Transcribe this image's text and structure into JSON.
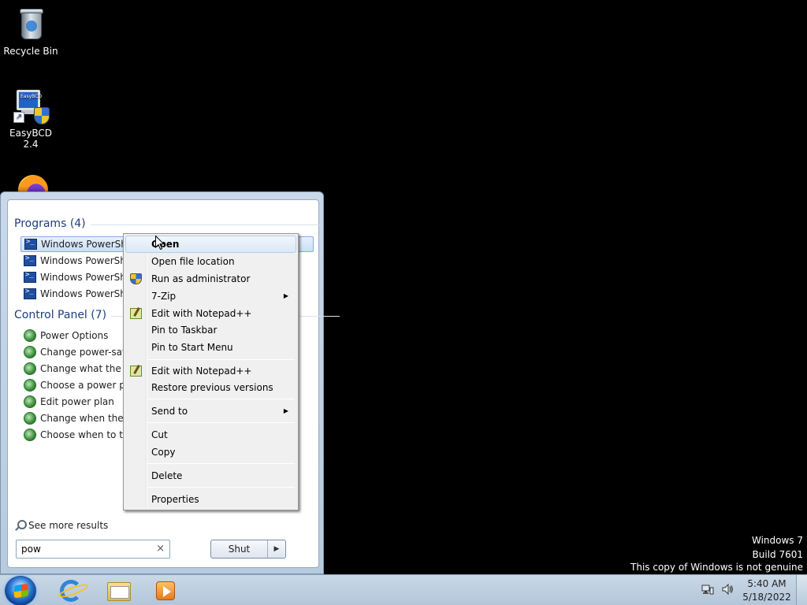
{
  "desktop": {
    "icons": [
      {
        "label": "Recycle Bin",
        "icon": "recycle-bin-icon"
      },
      {
        "label": "EasyBCD 2.4",
        "icon": "easybcd-icon"
      },
      {
        "label": "",
        "icon": "firefox-icon"
      }
    ],
    "easybcd_screen_text": "EasyBCD"
  },
  "start_menu": {
    "programs_header": "Programs (4)",
    "programs": [
      {
        "label": "Windows PowerShell",
        "selected": true
      },
      {
        "label": "Windows PowerShell"
      },
      {
        "label": "Windows PowerShell"
      },
      {
        "label": "Windows PowerShell"
      }
    ],
    "control_panel_header": "Control Panel (7)",
    "control_panel_items": [
      {
        "label": "Power Options"
      },
      {
        "label": "Change power-saving settings"
      },
      {
        "label": "Change what the power buttons do"
      },
      {
        "label": "Choose a power plan"
      },
      {
        "label": "Edit power plan"
      },
      {
        "label": "Change when the computer sleeps"
      },
      {
        "label": "Choose when to turn off display"
      }
    ],
    "see_more": "See more results",
    "search": {
      "value": "pow",
      "clear_icon": "×"
    },
    "shutdown_label": "Shut down",
    "shutdown_arrow": "▶"
  },
  "context_menu": {
    "items": [
      {
        "label": "Open",
        "bold": true,
        "hover": true
      },
      {
        "label": "Open file location"
      },
      {
        "label": "Run as administrator",
        "icon": "uac-shield-icon"
      },
      {
        "label": "7-Zip",
        "submenu": true
      },
      {
        "label": "Edit with Notepad++",
        "icon": "notepad-plus-plus-icon"
      },
      {
        "label": "Pin to Taskbar"
      },
      {
        "label": "Pin to Start Menu"
      },
      {
        "label": "Edit with Notepad++",
        "icon": "notepad-plus-plus-icon"
      },
      {
        "label": "Restore previous versions"
      },
      {
        "label": "Send to",
        "submenu": true
      },
      {
        "label": "Cut"
      },
      {
        "label": "Copy"
      },
      {
        "label": "Delete"
      },
      {
        "label": "Properties"
      }
    ],
    "submenu_arrow": "▶"
  },
  "watermark": {
    "line1": "Windows 7",
    "line2": "Build 7601",
    "line3": "This copy of Windows is not genuine"
  },
  "taskbar": {
    "pinned": [
      {
        "name": "Internet Explorer",
        "icon": "internet-explorer-icon"
      },
      {
        "name": "Windows Explorer",
        "icon": "windows-explorer-icon"
      },
      {
        "name": "Windows Media Player",
        "icon": "windows-media-player-icon"
      }
    ],
    "clock": {
      "time": "5:40 AM",
      "date": "5/18/2022"
    }
  },
  "colors": {
    "desktop_background": "#000000",
    "start_menu_header": "#1e3e7b",
    "selection_border": "#84acdd"
  }
}
